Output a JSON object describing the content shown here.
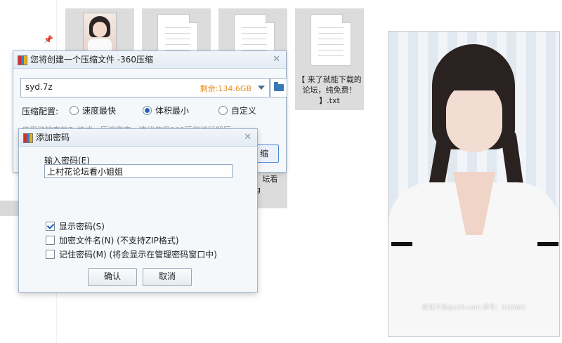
{
  "explorer": {
    "tile4_caption": "【 来了就能下载的论坛，纯免费！ 】.txt",
    "behind_caption": "码：】坛看小pg"
  },
  "photo": {
    "watermark": "黄油下载@z1h.com 房号：510601"
  },
  "main_dialog": {
    "title": "您将创建一个压缩文件 -360压缩",
    "path_value": "syd.7z",
    "free_space": "剩余:134.6GB",
    "config_label": "压缩配置:",
    "options": [
      "速度最快",
      "体积最小",
      "自定义"
    ],
    "selected_option": "体积最小",
    "hint_text": "使用了较高的7z格式，压缩率高，建议使用360压缩进行解压",
    "start_button": "缩"
  },
  "password_dialog": {
    "title": "添加密码",
    "input_label": "输入密码(E)",
    "password_value": "上村花论坛看小姐姐",
    "checkboxes": [
      {
        "label": "显示密码(S)",
        "checked": true
      },
      {
        "label": "加密文件名(N) (不支持ZIP格式)",
        "checked": false
      },
      {
        "label": "记住密码(M) (将会显示在管理密码窗口中)",
        "checked": false
      }
    ],
    "ok_button": "确认",
    "cancel_button": "取消"
  },
  "colors": {
    "accent": "#2a62b8",
    "free_space": "#e88a1a",
    "dialog_border": "#9db3cc"
  }
}
